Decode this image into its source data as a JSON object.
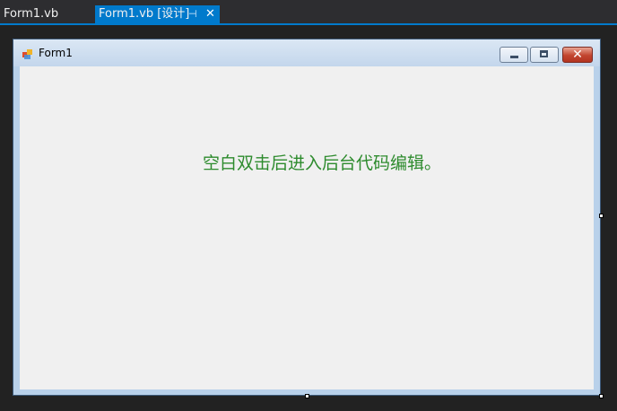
{
  "tabs": [
    {
      "label": "Form1.vb",
      "active": false
    },
    {
      "label": "Form1.vb [设计]",
      "active": true,
      "pin_icon": "pin-icon",
      "close_icon": "close-icon"
    }
  ],
  "form": {
    "title": "Form1",
    "icon": "form-app-icon",
    "caption_buttons": [
      "minimize-icon",
      "maximize-icon",
      "close-icon"
    ],
    "label_text": "空白双击后进入后台代码编辑。",
    "label_color": "#2d8b2d",
    "client_background": "#f0f0f0"
  },
  "colors": {
    "accent": "#007acc",
    "ide_background": "#1e1e1e"
  }
}
